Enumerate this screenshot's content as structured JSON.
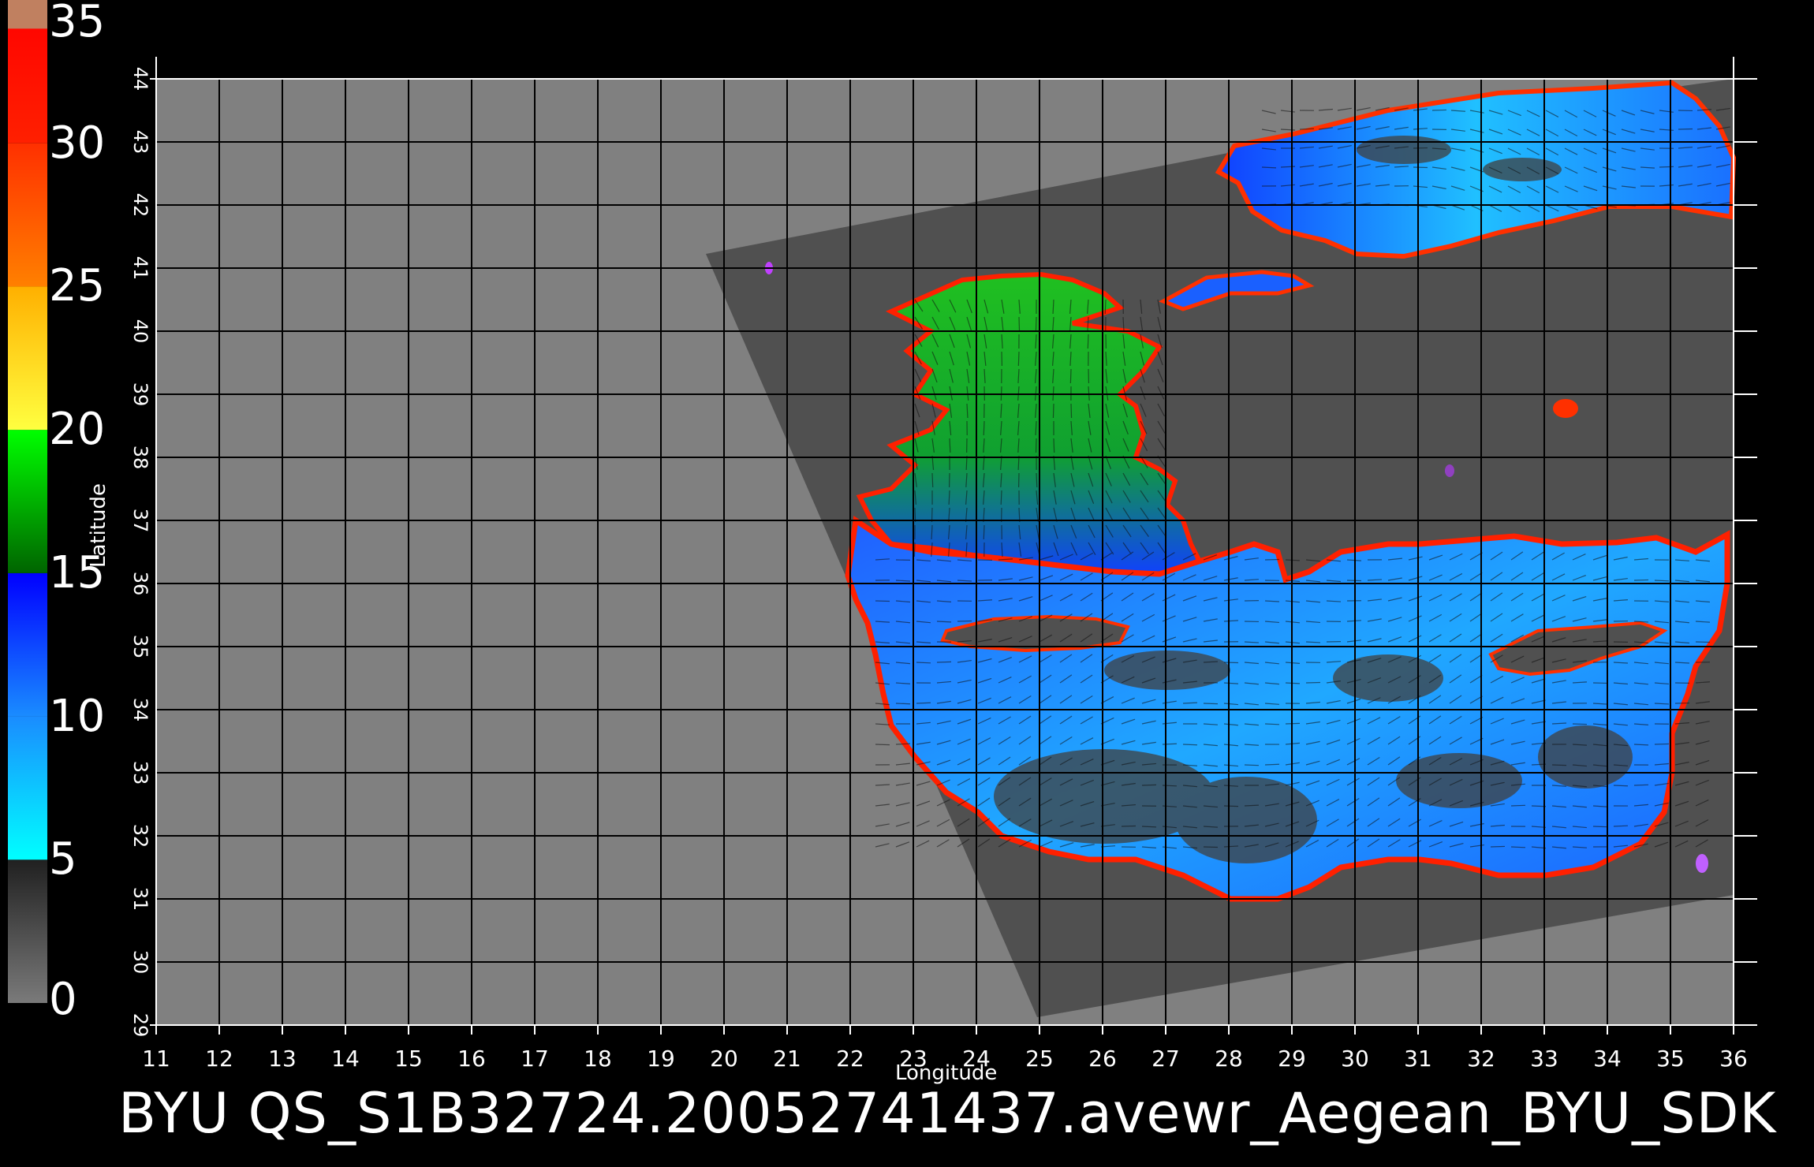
{
  "title": "BYU  QS_S1B32724.20052741437.avewr_Aegean_BYU_SDK",
  "axes": {
    "xlabel": "Longitude",
    "ylabel": "Latitude",
    "xlim": [
      11,
      36
    ],
    "ylim": [
      29,
      44
    ],
    "x_ticks": [
      "11",
      "12",
      "13",
      "14",
      "15",
      "16",
      "17",
      "18",
      "19",
      "20",
      "21",
      "22",
      "23",
      "24",
      "25",
      "26",
      "27",
      "28",
      "29",
      "30",
      "31",
      "32",
      "33",
      "34",
      "35",
      "36"
    ],
    "y_ticks": [
      "29",
      "30",
      "31",
      "32",
      "33",
      "34",
      "35",
      "36",
      "37",
      "38",
      "39",
      "40",
      "41",
      "42",
      "43",
      "44"
    ],
    "grid": true
  },
  "colorbar": {
    "labels": [
      "35",
      "30",
      "25",
      "20",
      "15",
      "10",
      "5",
      "0"
    ],
    "range": [
      0,
      35
    ],
    "segments": [
      {
        "from": 0,
        "to": 5,
        "colors": [
          "#7a7a7a",
          "#202020"
        ]
      },
      {
        "from": 5,
        "to": 10,
        "colors": [
          "#00ffff",
          "#1a8cff"
        ]
      },
      {
        "from": 10,
        "to": 15,
        "colors": [
          "#1a8cff",
          "#0000ff"
        ]
      },
      {
        "from": 15,
        "to": 20,
        "colors": [
          "#006400",
          "#00ff00"
        ]
      },
      {
        "from": 20,
        "to": 25,
        "colors": [
          "#ffff40",
          "#ffb000"
        ]
      },
      {
        "from": 25,
        "to": 30,
        "colors": [
          "#ff8000",
          "#ff3000"
        ]
      },
      {
        "from": 30,
        "to": 35,
        "colors": [
          "#ff2000",
          "#ff0000"
        ]
      },
      {
        "from": 34,
        "to": 35,
        "colors": [
          "#c08060",
          "#c08060"
        ]
      }
    ]
  },
  "colors": {
    "land": "#808080",
    "swath": "#505050",
    "grid": "#000000",
    "text": "#ffffff",
    "background": "#000000",
    "sea_low": "#1ec8ff",
    "sea_mid": "#1a50ff",
    "sea_high": "#00c000",
    "coast": "#ff2000"
  }
}
